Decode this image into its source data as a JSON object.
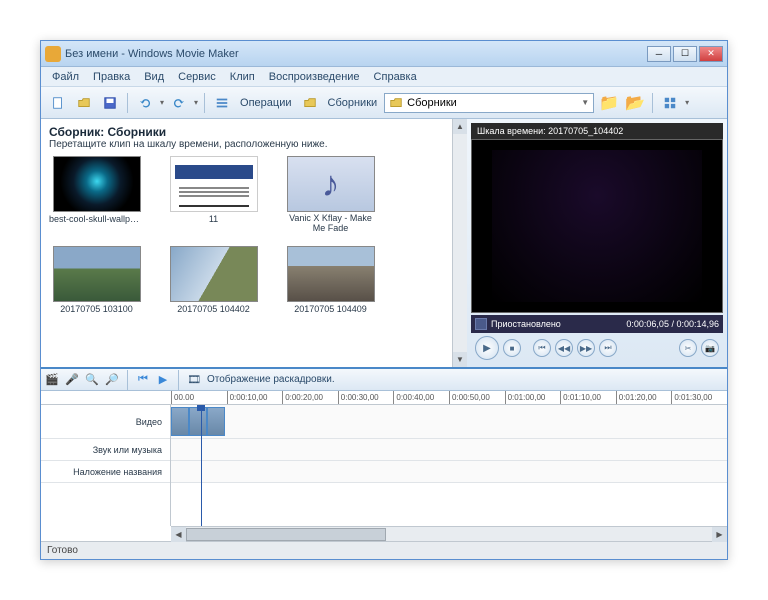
{
  "window": {
    "title": "Без имени - Windows Movie Maker"
  },
  "menu": [
    "Файл",
    "Правка",
    "Вид",
    "Сервис",
    "Клип",
    "Воспроизведение",
    "Справка"
  ],
  "toolbar": {
    "operations": "Операции",
    "collections": "Сборники",
    "combo_selected": "Сборники"
  },
  "collections": {
    "title": "Сборник: Сборники",
    "subtitle": "Перетащите клип на шкалу времени, расположенную ниже.",
    "items": [
      {
        "label": "best-cool-skull-wallpap...",
        "kind": "skull"
      },
      {
        "label": "11",
        "kind": "doc"
      },
      {
        "label": "Vanic X Kflay - Make Me Fade",
        "kind": "audio"
      },
      {
        "label": "20170705 103100",
        "kind": "photo1"
      },
      {
        "label": "20170705 104402",
        "kind": "photo2"
      },
      {
        "label": "20170705 104409",
        "kind": "photo3"
      }
    ]
  },
  "preview": {
    "header": "Шкала времени: 20170705_104402",
    "status": "Приостановлено",
    "time": "0:00:06,05 / 0:00:14,96"
  },
  "timeline": {
    "view_label": "Отображение раскадровки.",
    "ticks": [
      "00.00",
      "0:00:10,00",
      "0:00:20,00",
      "0:00:30,00",
      "0:00:40,00",
      "0:00:50,00",
      "0:01:00,00",
      "0:01:10,00",
      "0:01:20,00",
      "0:01:30,00"
    ],
    "rows": {
      "video": "Видео",
      "audio": "Звук или музыка",
      "title": "Наложение названия"
    }
  },
  "status": "Готово"
}
